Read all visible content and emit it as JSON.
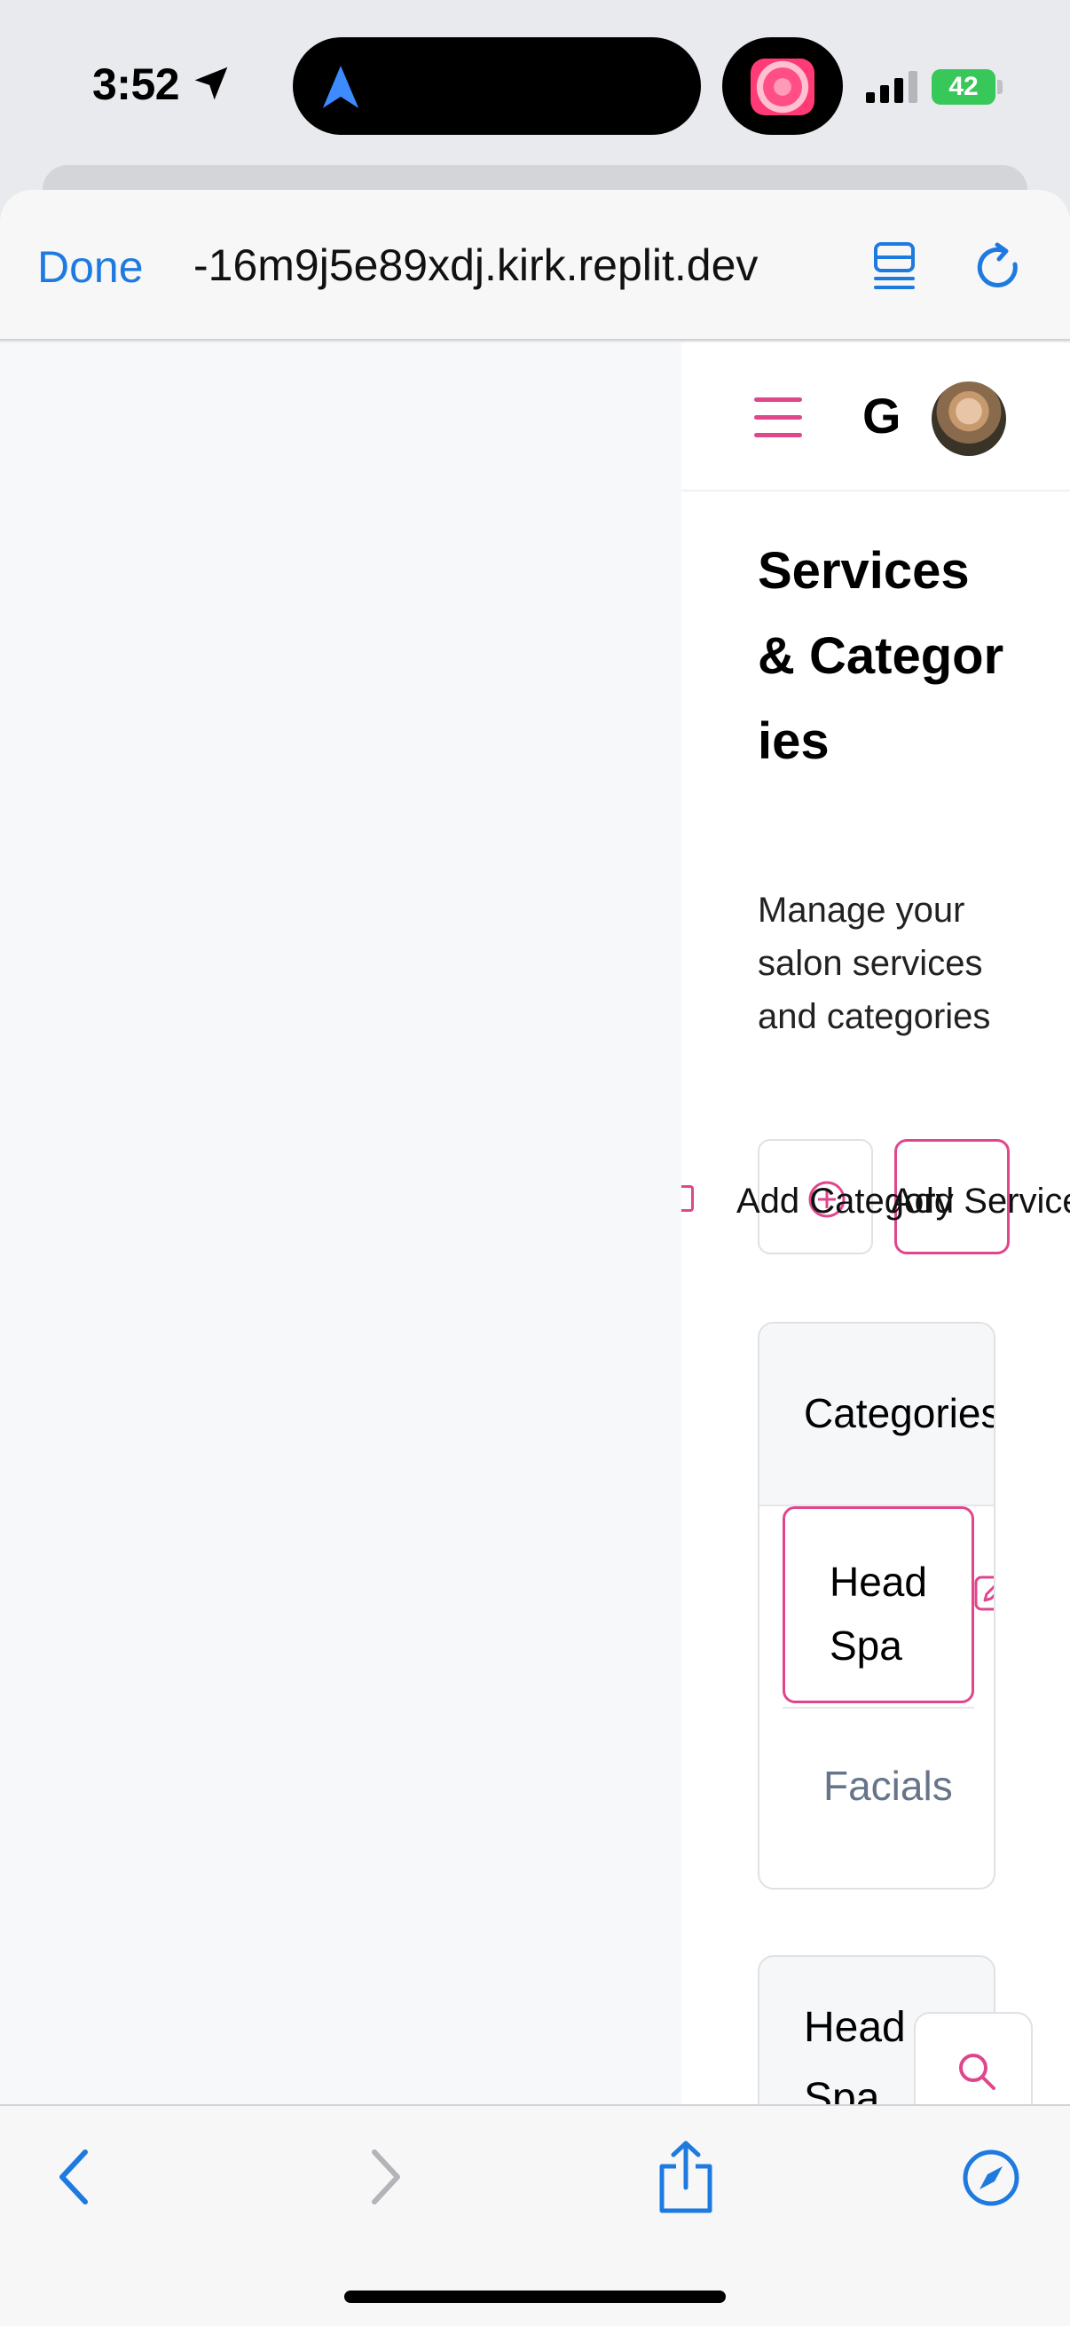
{
  "status_bar": {
    "time": "3:52",
    "battery": "42"
  },
  "browser": {
    "done_label": "Done",
    "url": "-16m9j5e89xdj.kirk.replit.dev"
  },
  "app": {
    "header_initial": "G",
    "page_title": "Services & Categories",
    "page_subtitle": "Manage your salon services and categories",
    "add_category_label": "Add Category",
    "add_service_label": "Add Service",
    "categories_card": {
      "title": "Categories",
      "items": [
        "Head Spa",
        "Facials"
      ]
    },
    "service_card_title": "Head Spa"
  },
  "colors": {
    "accent": "#e0468c",
    "ios_blue": "#1f7ae0",
    "muted_text": "#66758a"
  }
}
